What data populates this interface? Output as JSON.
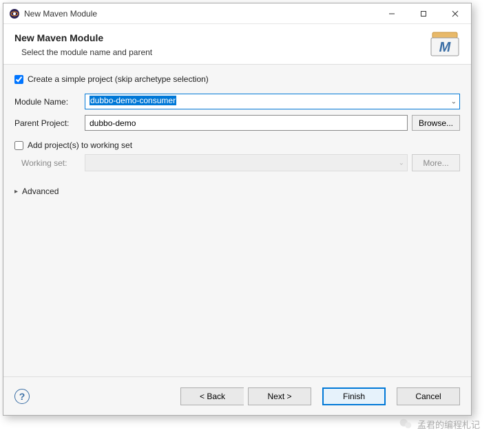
{
  "titlebar": {
    "title": "New Maven Module"
  },
  "header": {
    "title": "New Maven Module",
    "subtitle": "Select the module name and parent"
  },
  "form": {
    "simple_project_label": "Create a simple project (skip archetype selection)",
    "simple_project_checked": true,
    "module_name_label": "Module Name:",
    "module_name_value": "dubbo-demo-consumer",
    "parent_project_label": "Parent Project:",
    "parent_project_value": "dubbo-demo",
    "browse_label": "Browse...",
    "add_working_set_label": "Add project(s) to working set",
    "add_working_set_checked": false,
    "working_set_label": "Working set:",
    "more_label": "More...",
    "advanced_label": "Advanced"
  },
  "footer": {
    "back_label": "< Back",
    "next_label": "Next >",
    "finish_label": "Finish",
    "cancel_label": "Cancel"
  },
  "watermark": {
    "text": "孟君的编程札记"
  }
}
